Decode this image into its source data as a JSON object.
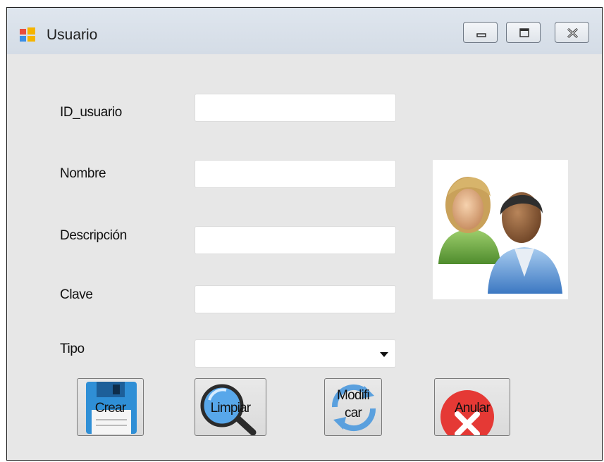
{
  "window": {
    "title": "Usuario",
    "icon": "windows-form-icon",
    "controls": [
      "minimize-icon",
      "maximize-icon",
      "close-icon"
    ]
  },
  "form": {
    "id_label": "ID_usuario",
    "id_value": "",
    "nombre_label": "Nombre",
    "nombre_value": "",
    "descripcion_label": "Descripción",
    "descripcion_value": "",
    "clave_label": "Clave",
    "clave_value": "",
    "tipo_label": "Tipo",
    "tipo_value": ""
  },
  "picture": {
    "icon": "users-icon"
  },
  "buttons": {
    "crear": {
      "label": "Crear",
      "icon": "floppy-disk-icon"
    },
    "limpiar": {
      "label": "Limpiar",
      "icon": "magnifier-icon"
    },
    "modificar": {
      "label_line1": "Modifi",
      "label_line2": "car",
      "icon": "refresh-icon"
    },
    "anular": {
      "label": "Anular",
      "icon": "red-x-icon"
    }
  },
  "colors": {
    "titlebar": "#d4dce6",
    "client": "#e7e7e7",
    "floppy": "#2f8fd6",
    "anular_red": "#e53935"
  }
}
